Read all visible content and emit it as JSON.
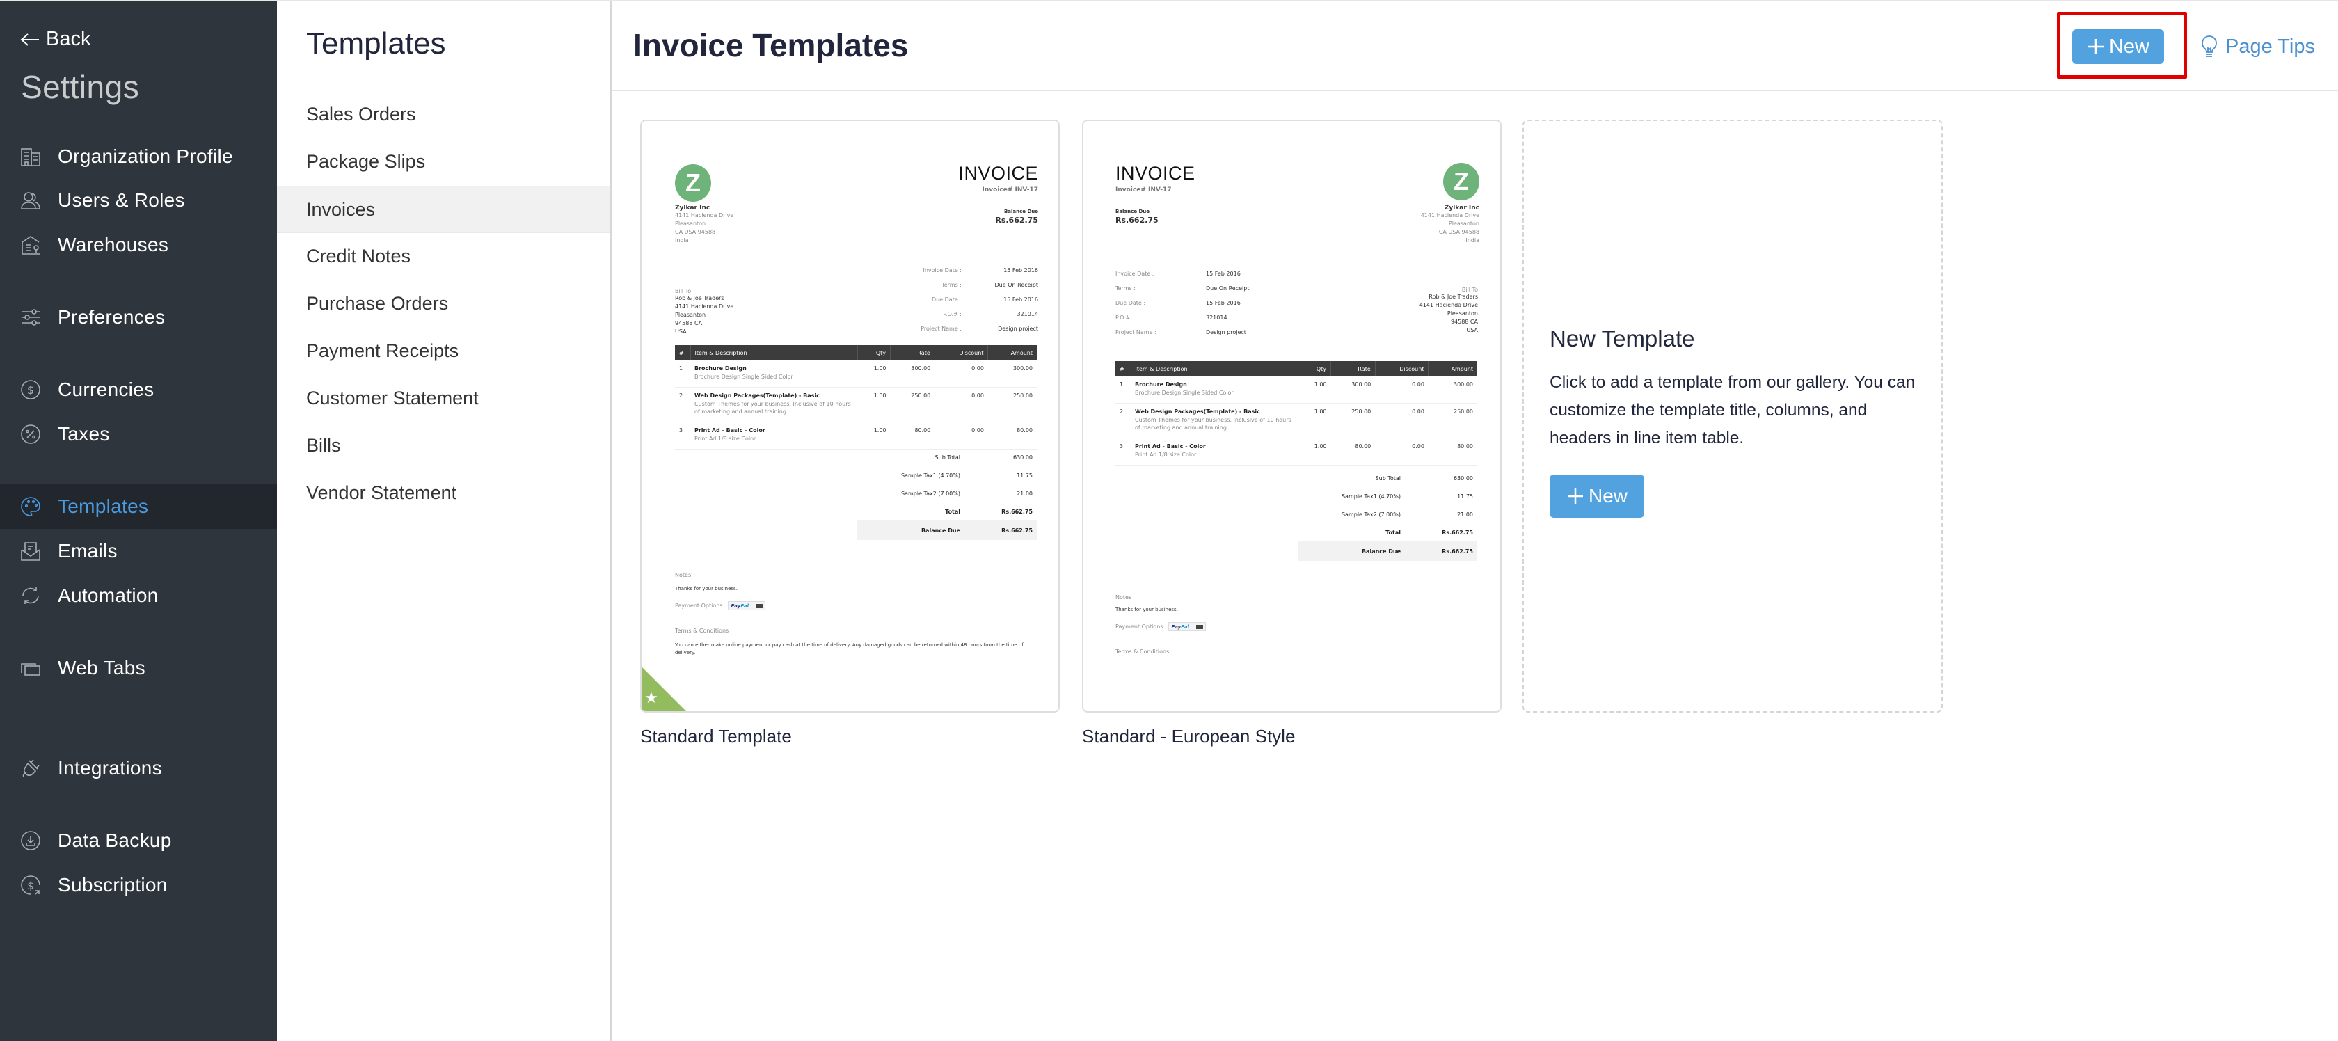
{
  "sidebar": {
    "back_label": "Back",
    "title": "Settings",
    "items": [
      {
        "label": "Organization Profile",
        "icon": "building-icon"
      },
      {
        "label": "Users & Roles",
        "icon": "users-icon"
      },
      {
        "label": "Warehouses",
        "icon": "warehouse-icon"
      },
      {
        "label": "Preferences",
        "icon": "sliders-icon"
      },
      {
        "label": "Currencies",
        "icon": "currency-icon"
      },
      {
        "label": "Taxes",
        "icon": "percent-icon"
      },
      {
        "label": "Templates",
        "icon": "palette-icon",
        "active": true
      },
      {
        "label": "Emails",
        "icon": "email-icon"
      },
      {
        "label": "Automation",
        "icon": "refresh-icon"
      },
      {
        "label": "Web Tabs",
        "icon": "tabs-icon"
      },
      {
        "label": "Integrations",
        "icon": "plug-icon"
      },
      {
        "label": "Data Backup",
        "icon": "download-icon"
      },
      {
        "label": "Subscription",
        "icon": "subscription-icon"
      }
    ]
  },
  "templates_list": {
    "title": "Templates",
    "items": [
      {
        "label": "Sales Orders"
      },
      {
        "label": "Package Slips"
      },
      {
        "label": "Invoices",
        "active": true
      },
      {
        "label": "Credit Notes"
      },
      {
        "label": "Purchase Orders"
      },
      {
        "label": "Payment Receipts"
      },
      {
        "label": "Customer Statement"
      },
      {
        "label": "Bills"
      },
      {
        "label": "Vendor Statement"
      }
    ]
  },
  "header": {
    "title": "Invoice Templates",
    "new_button": "New",
    "page_tips": "Page Tips"
  },
  "colors": {
    "accent": "#52a2e0",
    "sidebar_bg": "#2f353c",
    "highlight_box": "#e00000",
    "logo_green": "#6db37a",
    "default_badge": "#93bc5e"
  },
  "invoice_sample": {
    "title": "INVOICE",
    "number": "Invoice# INV-17",
    "balance_due_label": "Balance Due",
    "balance_due": "Rs.662.75",
    "logo_letter": "Z",
    "org": {
      "name": "Zylkar Inc",
      "address": [
        "4141 Hacienda Drive",
        "Pleasanton",
        "CA USA 94588",
        "India"
      ]
    },
    "bill_to_label": "Bill To",
    "bill_to": [
      "Rob & Joe Traders",
      "4141 Hacienda Drive",
      "Pleasanton",
      "94588 CA",
      "USA"
    ],
    "meta": [
      {
        "k": "Invoice Date :",
        "v": "15 Feb 2016"
      },
      {
        "k": "Terms :",
        "v": "Due On Receipt"
      },
      {
        "k": "Due Date :",
        "v": "15 Feb 2016"
      },
      {
        "k": "P.O.# :",
        "v": "321014"
      },
      {
        "k": "Project Name :",
        "v": "Design project"
      }
    ],
    "columns": [
      "#",
      "Item & Description",
      "Qty",
      "Rate",
      "Discount",
      "Amount"
    ],
    "items": [
      {
        "n": "1",
        "name": "Brochure Design",
        "desc": "Brochure Design Single Sided Color",
        "qty": "1.00",
        "rate": "300.00",
        "discount": "0.00",
        "amount": "300.00"
      },
      {
        "n": "2",
        "name": "Web Design Packages(Template) - Basic",
        "desc": "Custom Themes for your business. Inclusive of 10 hours of marketing and annual training",
        "qty": "1.00",
        "rate": "250.00",
        "discount": "0.00",
        "amount": "250.00"
      },
      {
        "n": "3",
        "name": "Print Ad - Basic - Color",
        "desc": "Print Ad 1/8 size Color",
        "qty": "1.00",
        "rate": "80.00",
        "discount": "0.00",
        "amount": "80.00"
      }
    ],
    "totals": [
      {
        "k": "Sub Total",
        "v": "630.00"
      },
      {
        "k": "Sample Tax1 (4.70%)",
        "v": "11.75"
      },
      {
        "k": "Sample Tax2 (7.00%)",
        "v": "21.00"
      },
      {
        "k": "Total",
        "v": "Rs.662.75"
      },
      {
        "k": "Balance Due",
        "v": "Rs.662.75"
      }
    ],
    "notes_label": "Notes",
    "notes": "Thanks for your business.",
    "payment_options_label": "Payment Options",
    "paypal": [
      "Pay",
      "Pal"
    ],
    "terms_label": "Terms & Conditions",
    "terms": "You can either make online payment or pay cash at the time of delivery. Any damaged goods can be returned within 48 hours from the time of delivery."
  },
  "cards": [
    {
      "label": "Standard Template",
      "default": true
    },
    {
      "label": "Standard - European Style"
    }
  ],
  "new_template": {
    "title": "New Template",
    "description": "Click to add a template from our gallery. You can customize the template title, columns, and headers in line item table.",
    "button": "New"
  }
}
